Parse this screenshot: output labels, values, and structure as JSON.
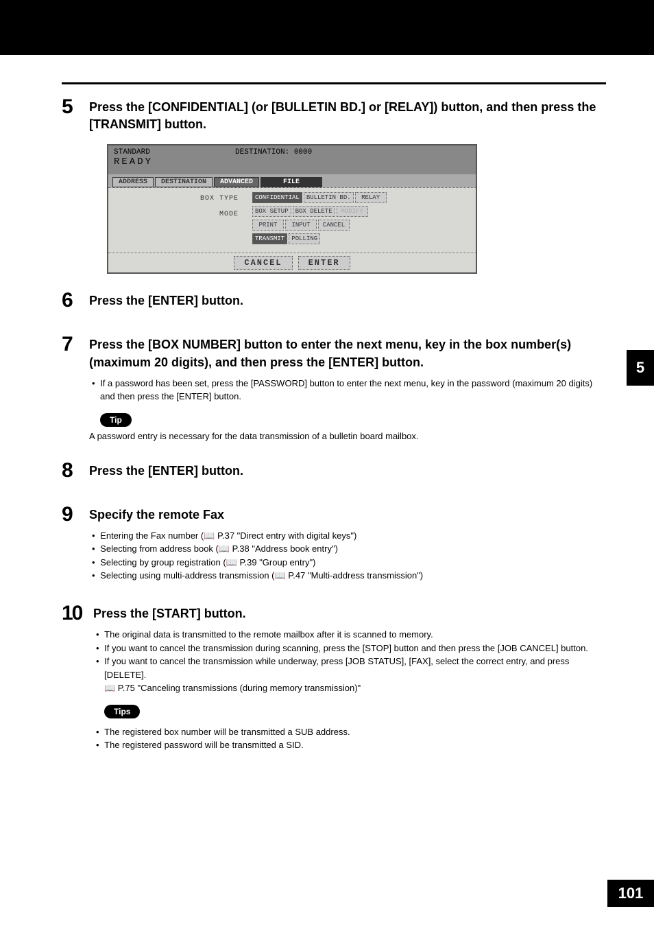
{
  "chapter_tab": "5",
  "page_number": "101",
  "step5": {
    "num": "5",
    "title": "Press the [CONFIDENTIAL] (or [BULLETIN BD.] or [RELAY]) button, and then press the [TRANSMIT] button."
  },
  "step6": {
    "num": "6",
    "title": "Press the [ENTER] button."
  },
  "step7": {
    "num": "7",
    "title": "Press the [BOX NUMBER] button to enter the next menu, key in the box number(s) (maximum 20 digits), and then press the [ENTER] button.",
    "bullet": "If a password has been set, press the [PASSWORD] button to enter the next menu, key in the password (maximum 20 digits) and then press the [ENTER] button.",
    "tip_label": "Tip",
    "tip_text": "A password entry is necessary for the data transmission of a bulletin board mailbox."
  },
  "step8": {
    "num": "8",
    "title": "Press the [ENTER] button."
  },
  "step9": {
    "num": "9",
    "title": "Specify the remote Fax",
    "bullets": [
      "Entering the Fax number (📖 P.37 \"Direct entry with digital keys\")",
      "Selecting from address book (📖 P.38 \"Address book entry\")",
      "Selecting by group registration (📖 P.39 \"Group entry\")",
      "Selecting using multi-address transmission (📖 P.47 \"Multi-address transmission\")"
    ]
  },
  "step10": {
    "num": "10",
    "title": "Press the [START] button.",
    "bullets": [
      "The original data is transmitted to the remote mailbox after it is scanned to memory.",
      "If you want to cancel the transmission during scanning, press the [STOP] button and then press the [JOB CANCEL] button.",
      "If you want to cancel the transmission while underway, press [JOB STATUS], [FAX], select the correct entry, and press [DELETE].",
      "📖 P.75 \"Canceling transmissions (during memory transmission)\""
    ],
    "tips_label": "Tips",
    "tips": [
      "The registered box number will be transmitted a SUB address.",
      "The registered password will be transmitted a SID."
    ]
  },
  "shot": {
    "standard": "STANDARD",
    "ready": "READY",
    "destination": "DESTINATION: 0000",
    "tabs": {
      "address": "ADDRESS",
      "destination_tab": "DESTINATION",
      "advanced": "ADVANCED",
      "file": "FILE"
    },
    "body": {
      "box_type_label": "BOX TYPE",
      "mode_label": "MODE",
      "row1": {
        "confidential": "CONFIDENTIAL",
        "bulletin": "BULLETIN BD.",
        "relay": "RELAY"
      },
      "row2": {
        "box_setup": "BOX SETUP",
        "box_delete": "BOX DELETE",
        "modify": "MODIFY"
      },
      "row3": {
        "print": "PRINT",
        "input": "INPUT",
        "cancel": "CANCEL"
      },
      "row4": {
        "transmit": "TRANSMIT",
        "polling": "POLLING"
      }
    },
    "footer": {
      "cancel": "CANCEL",
      "enter": "ENTER"
    }
  }
}
